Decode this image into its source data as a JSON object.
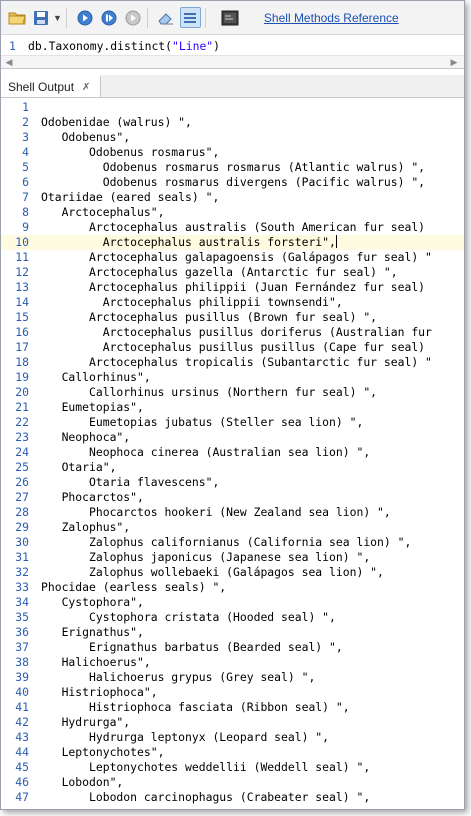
{
  "toolbar": {
    "link": "Shell Methods Reference",
    "buttons": [
      {
        "name": "open-folder-icon"
      },
      {
        "name": "save-icon"
      },
      {
        "name": "save-dropdown-icon"
      },
      {
        "name": "run-icon"
      },
      {
        "name": "step-icon"
      },
      {
        "name": "stop-icon"
      },
      {
        "name": "clear-icon"
      },
      {
        "name": "output-view-icon"
      },
      {
        "name": "console-icon"
      }
    ]
  },
  "editor": {
    "line_number": "1",
    "code_prefix": "db.Taxonomy.distinct(",
    "code_string": "\"Line\"",
    "code_suffix": ")"
  },
  "tab": {
    "label": "Shell Output",
    "close": "✗"
  },
  "output": {
    "current_line": 10,
    "lines": [
      {
        "n": "1",
        "t": ""
      },
      {
        "n": "2",
        "t": "Odobenidae (walrus) \","
      },
      {
        "n": "3",
        "t": "   Odobenus\","
      },
      {
        "n": "4",
        "t": "       Odobenus rosmarus\","
      },
      {
        "n": "5",
        "t": "         Odobenus rosmarus rosmarus (Atlantic walrus) \","
      },
      {
        "n": "6",
        "t": "         Odobenus rosmarus divergens (Pacific walrus) \","
      },
      {
        "n": "7",
        "t": "Otariidae (eared seals) \","
      },
      {
        "n": "8",
        "t": "   Arctocephalus\","
      },
      {
        "n": "9",
        "t": "       Arctocephalus australis (South American fur seal)"
      },
      {
        "n": "10",
        "t": "         Arctocephalus australis forsteri\","
      },
      {
        "n": "11",
        "t": "       Arctocephalus galapagoensis (Galápagos fur seal) \""
      },
      {
        "n": "12",
        "t": "       Arctocephalus gazella (Antarctic fur seal) \","
      },
      {
        "n": "13",
        "t": "       Arctocephalus philippii (Juan Fernández fur seal)"
      },
      {
        "n": "14",
        "t": "         Arctocephalus philippii townsendi\","
      },
      {
        "n": "15",
        "t": "       Arctocephalus pusillus (Brown fur seal) \","
      },
      {
        "n": "16",
        "t": "         Arctocephalus pusillus doriferus (Australian fur"
      },
      {
        "n": "17",
        "t": "         Arctocephalus pusillus pusillus (Cape fur seal)"
      },
      {
        "n": "18",
        "t": "       Arctocephalus tropicalis (Subantarctic fur seal) \""
      },
      {
        "n": "19",
        "t": "   Callorhinus\","
      },
      {
        "n": "20",
        "t": "       Callorhinus ursinus (Northern fur seal) \","
      },
      {
        "n": "21",
        "t": "   Eumetopias\","
      },
      {
        "n": "22",
        "t": "       Eumetopias jubatus (Steller sea lion) \","
      },
      {
        "n": "23",
        "t": "   Neophoca\","
      },
      {
        "n": "24",
        "t": "       Neophoca cinerea (Australian sea lion) \","
      },
      {
        "n": "25",
        "t": "   Otaria\","
      },
      {
        "n": "26",
        "t": "       Otaria flavescens\","
      },
      {
        "n": "27",
        "t": "   Phocarctos\","
      },
      {
        "n": "28",
        "t": "       Phocarctos hookeri (New Zealand sea lion) \","
      },
      {
        "n": "29",
        "t": "   Zalophus\","
      },
      {
        "n": "30",
        "t": "       Zalophus californianus (California sea lion) \","
      },
      {
        "n": "31",
        "t": "       Zalophus japonicus (Japanese sea lion) \","
      },
      {
        "n": "32",
        "t": "       Zalophus wollebaeki (Galápagos sea lion) \","
      },
      {
        "n": "33",
        "t": "Phocidae (earless seals) \","
      },
      {
        "n": "34",
        "t": "   Cystophora\","
      },
      {
        "n": "35",
        "t": "       Cystophora cristata (Hooded seal) \","
      },
      {
        "n": "36",
        "t": "   Erignathus\","
      },
      {
        "n": "37",
        "t": "       Erignathus barbatus (Bearded seal) \","
      },
      {
        "n": "38",
        "t": "   Halichoerus\","
      },
      {
        "n": "39",
        "t": "       Halichoerus grypus (Grey seal) \","
      },
      {
        "n": "40",
        "t": "   Histriophoca\","
      },
      {
        "n": "41",
        "t": "       Histriophoca fasciata (Ribbon seal) \","
      },
      {
        "n": "42",
        "t": "   Hydrurga\","
      },
      {
        "n": "43",
        "t": "       Hydrurga leptonyx (Leopard seal) \","
      },
      {
        "n": "44",
        "t": "   Leptonychotes\","
      },
      {
        "n": "45",
        "t": "       Leptonychotes weddellii (Weddell seal) \","
      },
      {
        "n": "46",
        "t": "   Lobodon\","
      },
      {
        "n": "47",
        "t": "       Lobodon carcinophagus (Crabeater seal) \","
      }
    ]
  },
  "colors": {
    "line_number": "#2a5db0",
    "string": "#2a00ff",
    "link": "#1a4fb4",
    "current_line_bg": "#fffbe0"
  }
}
